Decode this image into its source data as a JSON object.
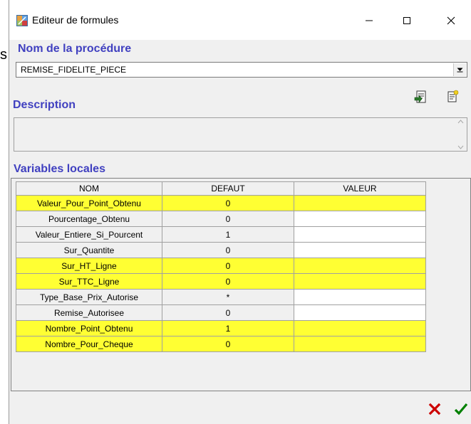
{
  "background_letter": "s",
  "window": {
    "title": "Editeur de formules",
    "minimize_glyph": "—",
    "maximize_glyph": "☐",
    "close_glyph": "✕"
  },
  "procedure": {
    "label": "Nom de la procédure",
    "value": "REMISE_FIDELITE_PIECE"
  },
  "description": {
    "label": "Description",
    "value": ""
  },
  "variables": {
    "label": "Variables locales",
    "columns": [
      "NOM",
      "DEFAUT",
      "VALEUR"
    ],
    "rows": [
      {
        "nom": "Valeur_Pour_Point_Obtenu",
        "defaut": "0",
        "valeur": "",
        "highlight": true
      },
      {
        "nom": "Pourcentage_Obtenu",
        "defaut": "0",
        "valeur": "",
        "highlight": false
      },
      {
        "nom": "Valeur_Entiere_Si_Pourcent",
        "defaut": "1",
        "valeur": "",
        "highlight": false
      },
      {
        "nom": "Sur_Quantite",
        "defaut": "0",
        "valeur": "",
        "highlight": false
      },
      {
        "nom": "Sur_HT_Ligne",
        "defaut": "0",
        "valeur": "",
        "highlight": true
      },
      {
        "nom": "Sur_TTC_Ligne",
        "defaut": "0",
        "valeur": "",
        "highlight": true
      },
      {
        "nom": "Type_Base_Prix_Autorise",
        "defaut": "*",
        "valeur": "",
        "highlight": false
      },
      {
        "nom": "Remise_Autorisee",
        "defaut": "0",
        "valeur": "",
        "highlight": false
      },
      {
        "nom": "Nombre_Point_Obtenu",
        "defaut": "1",
        "valeur": "",
        "highlight": true
      },
      {
        "nom": "Nombre_Pour_Cheque",
        "defaut": "0",
        "valeur": "",
        "highlight": true
      }
    ]
  },
  "colors": {
    "section_label": "#4040c0",
    "highlight": "#ffff33",
    "cancel": "#cc0000",
    "ok": "#008000"
  },
  "icons": {
    "app": "formula-editor-app-icon",
    "tool1": "import-document-icon",
    "tool2": "document-edit-icon",
    "cancel": "red-x-icon",
    "ok": "green-check-icon"
  }
}
